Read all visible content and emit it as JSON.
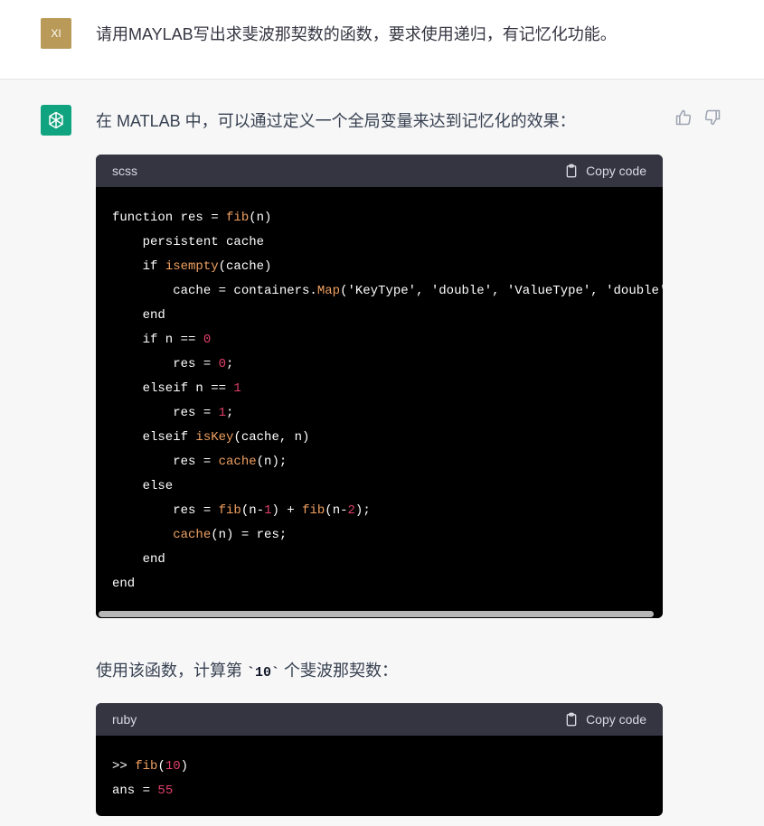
{
  "user_message": {
    "avatar_text": "XI",
    "text": "请用MAYLAB写出求斐波那契数的函数，要求使用递归，有记忆化功能。"
  },
  "assistant_message": {
    "intro": "在 MATLAB 中，可以通过定义一个全局变量来达到记忆化的效果：",
    "code_block_1": {
      "language": "scss",
      "copy_label": "Copy code",
      "lines": [
        "function res = fib(n)",
        "    persistent cache",
        "    if isempty(cache)",
        "        cache = containers.Map('KeyType', 'double', 'ValueType', 'double');",
        "    end",
        "    if n == 0",
        "        res = 0;",
        "    elseif n == 1",
        "        res = 1;",
        "    elseif isKey(cache, n)",
        "        res = cache(n);",
        "    else",
        "        res = fib(n-1) + fib(n-2);",
        "        cache(n) = res;",
        "    end",
        "end"
      ]
    },
    "para2": {
      "before": "使用该函数，计算第 ",
      "code": "`10`",
      "after": " 个斐波那契数："
    },
    "code_block_2": {
      "language": "ruby",
      "copy_label": "Copy code",
      "lines": [
        ">> fib(10)",
        "ans = 55"
      ]
    }
  },
  "icons": {
    "assistant_avatar": "openai-logo-icon",
    "thumbs_up": "thumbs-up-icon",
    "thumbs_down": "thumbs-down-icon",
    "copy": "clipboard-icon"
  },
  "colors": {
    "user_avatar_bg": "#b99a59",
    "assistant_avatar_bg": "#10a37f",
    "code_bg": "#000000",
    "code_header_bg": "#343541",
    "token_function": "#f0a060",
    "token_number": "#e04068"
  }
}
